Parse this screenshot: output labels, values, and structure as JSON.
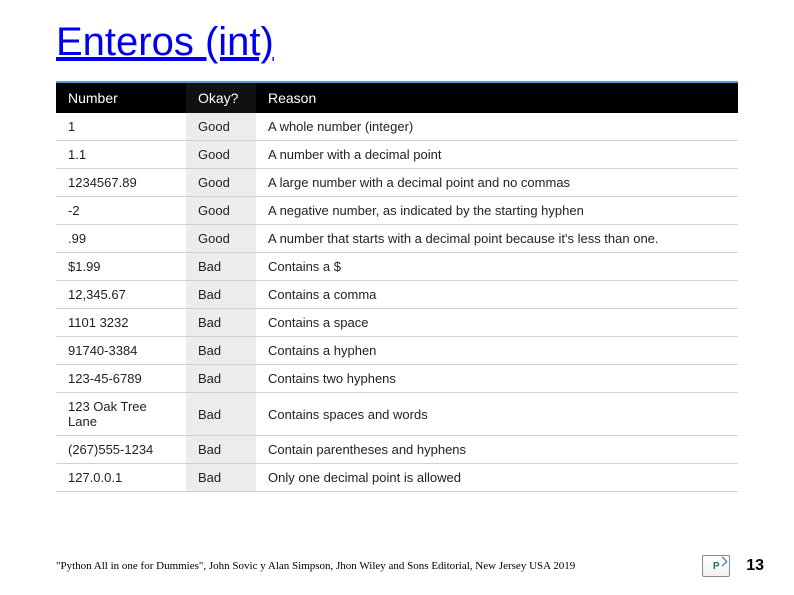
{
  "title": "Enteros (int)",
  "headers": {
    "number": "Number",
    "okay": "Okay?",
    "reason": "Reason"
  },
  "rows": [
    {
      "number": "1",
      "okay": "Good",
      "reason": "A whole number (integer)"
    },
    {
      "number": "1.1",
      "okay": "Good",
      "reason": "A number with a decimal point"
    },
    {
      "number": "1234567.89",
      "okay": "Good",
      "reason": "A large number with a decimal point and no commas"
    },
    {
      "number": "-2",
      "okay": "Good",
      "reason": "A negative number, as indicated by the starting hyphen"
    },
    {
      "number": ".99",
      "okay": "Good",
      "reason": "A number that starts with a decimal point because it's less than one."
    },
    {
      "number": "$1.99",
      "okay": "Bad",
      "reason": "Contains a $"
    },
    {
      "number": "12,345.67",
      "okay": "Bad",
      "reason": "Contains a comma"
    },
    {
      "number": "1101 3232",
      "okay": "Bad",
      "reason": "Contains a space"
    },
    {
      "number": "91740-3384",
      "okay": "Bad",
      "reason": "Contains a hyphen"
    },
    {
      "number": "123-45-6789",
      "okay": "Bad",
      "reason": "Contains two hyphens"
    },
    {
      "number": "123 Oak Tree Lane",
      "okay": "Bad",
      "reason": "Contains spaces and words"
    },
    {
      "number": "(267)555-1234",
      "okay": "Bad",
      "reason": "Contain parentheses and hyphens"
    },
    {
      "number": "127.0.0.1",
      "okay": "Bad",
      "reason": "Only one decimal point is allowed"
    }
  ],
  "citation": "\"Python All in one for Dummies\", John Sovic y Alan Simpson, Jhon Wiley and Sons Editorial, New Jersey USA 2019",
  "page_number": "13",
  "chart_data": {
    "type": "table",
    "title": "Enteros (int)",
    "columns": [
      "Number",
      "Okay?",
      "Reason"
    ],
    "rows": [
      [
        "1",
        "Good",
        "A whole number (integer)"
      ],
      [
        "1.1",
        "Good",
        "A number with a decimal point"
      ],
      [
        "1234567.89",
        "Good",
        "A large number with a decimal point and no commas"
      ],
      [
        "-2",
        "Good",
        "A negative number, as indicated by the starting hyphen"
      ],
      [
        ".99",
        "Good",
        "A number that starts with a decimal point because it's less than one."
      ],
      [
        "$1.99",
        "Bad",
        "Contains a $"
      ],
      [
        "12,345.67",
        "Bad",
        "Contains a comma"
      ],
      [
        "1101 3232",
        "Bad",
        "Contains a space"
      ],
      [
        "91740-3384",
        "Bad",
        "Contains a hyphen"
      ],
      [
        "123-45-6789",
        "Bad",
        "Contains two hyphens"
      ],
      [
        "123 Oak Tree Lane",
        "Bad",
        "Contains spaces and words"
      ],
      [
        "(267)555-1234",
        "Bad",
        "Contain parentheses and hyphens"
      ],
      [
        "127.0.0.1",
        "Bad",
        "Only one decimal point is allowed"
      ]
    ]
  }
}
